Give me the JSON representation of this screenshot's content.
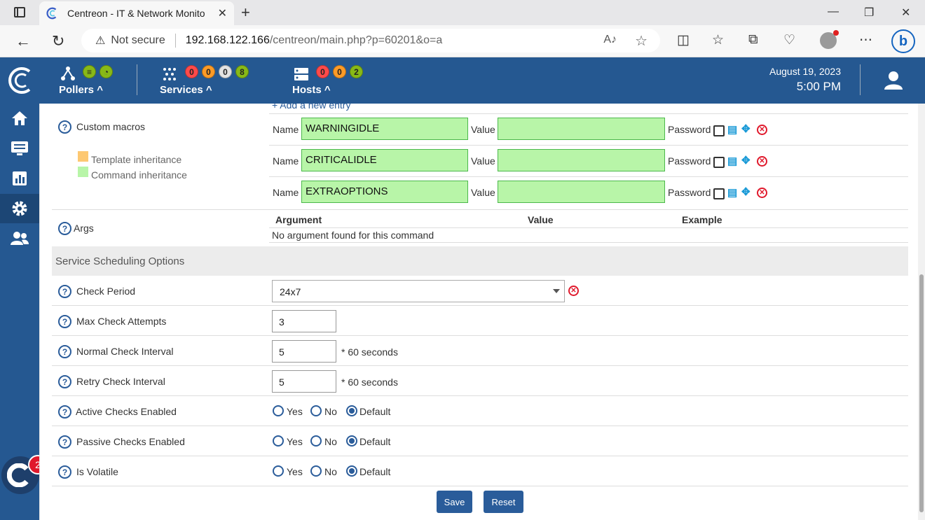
{
  "browser": {
    "tab_title": "Centreon - IT & Network Monito",
    "not_secure": "Not secure",
    "url_host": "192.168.122.166",
    "url_path": "/centreon/main.php?p=60201&o=a"
  },
  "header": {
    "pollers_label": "Pollers",
    "services_label": "Services",
    "services_counts": [
      "0",
      "0",
      "0",
      "8"
    ],
    "hosts_label": "Hosts",
    "hosts_counts": [
      "0",
      "0",
      "2"
    ],
    "date": "August 19, 2023",
    "time": "5:00 PM"
  },
  "notification_count": "2",
  "macros": {
    "add_entry": "+ Add a new entry",
    "label": "Custom macros",
    "legend_template": "Template inheritance",
    "legend_command": "Command inheritance",
    "name_label": "Name",
    "value_label": "Value",
    "password_label": "Password",
    "entries": [
      {
        "name": "WARNINGIDLE",
        "value": ""
      },
      {
        "name": "CRITICALIDLE",
        "value": ""
      },
      {
        "name": "EXTRAOPTIONS",
        "value": ""
      }
    ]
  },
  "args": {
    "label": "Args",
    "col_argument": "Argument",
    "col_value": "Value",
    "col_example": "Example",
    "empty": "No argument found for this command"
  },
  "scheduling": {
    "title": "Service Scheduling Options",
    "check_period_label": "Check Period",
    "check_period_value": "24x7",
    "max_attempts_label": "Max Check Attempts",
    "max_attempts_value": "3",
    "normal_interval_label": "Normal Check Interval",
    "normal_interval_value": "5",
    "retry_interval_label": "Retry Check Interval",
    "retry_interval_value": "5",
    "interval_unit": "* 60 seconds",
    "active_label": "Active Checks Enabled",
    "passive_label": "Passive Checks Enabled",
    "volatile_label": "Is Volatile",
    "opt_yes": "Yes",
    "opt_no": "No",
    "opt_default": "Default"
  },
  "buttons": {
    "save": "Save",
    "reset": "Reset"
  },
  "colors": {
    "brand": "#255891",
    "green": "#b8f5a8",
    "danger": "#e0192c"
  }
}
